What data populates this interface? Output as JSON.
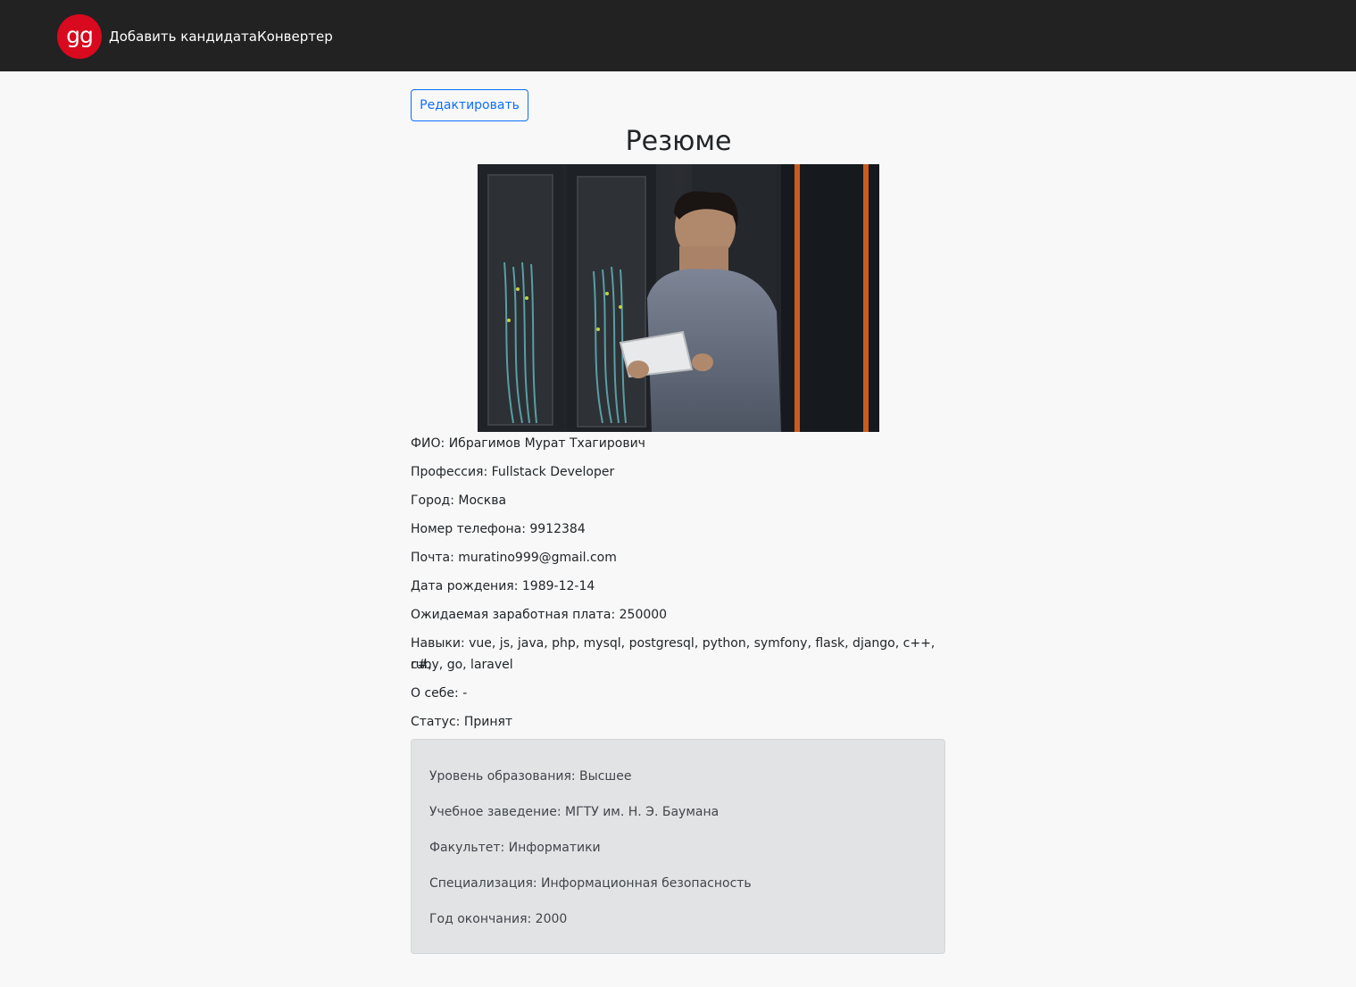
{
  "navbar": {
    "logo_text": "gg",
    "links": [
      "Добавить кандидата",
      "Конвертер"
    ]
  },
  "edit_button_label": "Редактировать",
  "title": "Резюме",
  "photo_alt": "",
  "info": {
    "fio": "ФИО: Ибрагимов Мурат Тхагирович",
    "profession": "Профессия: Fullstack Developer",
    "city": "Город: Москва",
    "phone": "Номер телефона: 9912384",
    "email": "Почта: muratino999@gmail.com",
    "birth_date": "Дата рождения: 1989-12-14",
    "salary": "Ожидаемая заработная плата: 250000",
    "skills_line1": "Навыки: vue, js, java, php, mysql, postgresql, python, symfony, flask, django, c++, c#,",
    "skills_line2": "ruby, go, laravel",
    "about": "О себе: -",
    "status": "Статус: Принят"
  },
  "education": {
    "level": "Уровень образования: Высшее",
    "institution": "Учебное заведение: МГТУ им. Н. Э. Баумана",
    "faculty": "Факультет: Информатики",
    "specialization": "Специализация: Информационная безопасность",
    "graduation_year": "Год окончания: 2000"
  },
  "colors": {
    "navbar_bg": "#222222",
    "logo_bg": "#d9091f",
    "accent": "#0d6efd",
    "page_bg": "#f8f8f8",
    "edu_bg": "#e2e3e5"
  }
}
